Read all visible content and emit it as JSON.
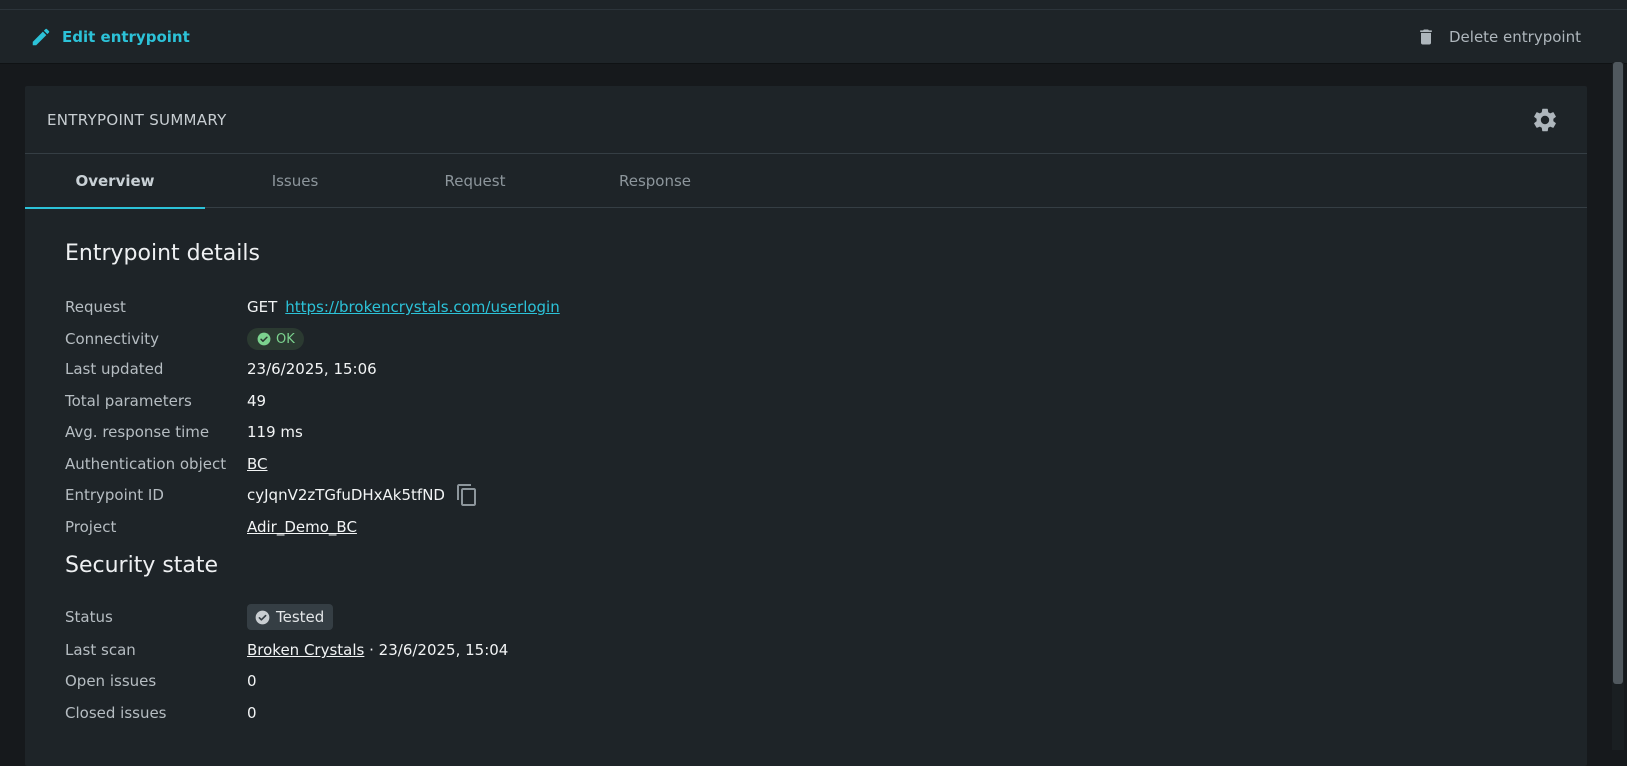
{
  "toolbar": {
    "edit_label": "Edit entrypoint",
    "delete_label": "Delete entrypoint"
  },
  "card": {
    "title": "ENTRYPOINT SUMMARY"
  },
  "tabs": [
    {
      "label": "Overview",
      "active": true
    },
    {
      "label": "Issues",
      "active": false
    },
    {
      "label": "Request",
      "active": false
    },
    {
      "label": "Response",
      "active": false
    }
  ],
  "details": {
    "title": "Entrypoint details",
    "request_label": "Request",
    "request_method": "GET",
    "request_url": "https://brokencrystals.com/userlogin",
    "connectivity_label": "Connectivity",
    "connectivity_value": "OK",
    "last_updated_label": "Last updated",
    "last_updated_value": "23/6/2025, 15:06",
    "total_params_label": "Total parameters",
    "total_params_value": "49",
    "avg_response_label": "Avg. response time",
    "avg_response_value": "119 ms",
    "auth_label": "Authentication object",
    "auth_value": "BC",
    "id_label": "Entrypoint ID",
    "id_value": "cyJqnV2zTGfuDHxAk5tfND",
    "project_label": "Project",
    "project_value": "Adir_Demo_BC"
  },
  "security": {
    "title": "Security state",
    "status_label": "Status",
    "status_value": "Tested",
    "last_scan_label": "Last scan",
    "last_scan_name": "Broken Crystals",
    "last_scan_sep": " · ",
    "last_scan_date": "23/6/2025, 15:04",
    "open_issues_label": "Open issues",
    "open_issues_value": "0",
    "closed_issues_label": "Closed issues",
    "closed_issues_value": "0"
  },
  "colors": {
    "accent": "#2cc2d8",
    "ok_green": "#7bd28e",
    "background": "#1e2428"
  },
  "icons": [
    "pencil-icon",
    "trash-icon",
    "gear-icon",
    "check-circle-icon",
    "copy-icon"
  ]
}
